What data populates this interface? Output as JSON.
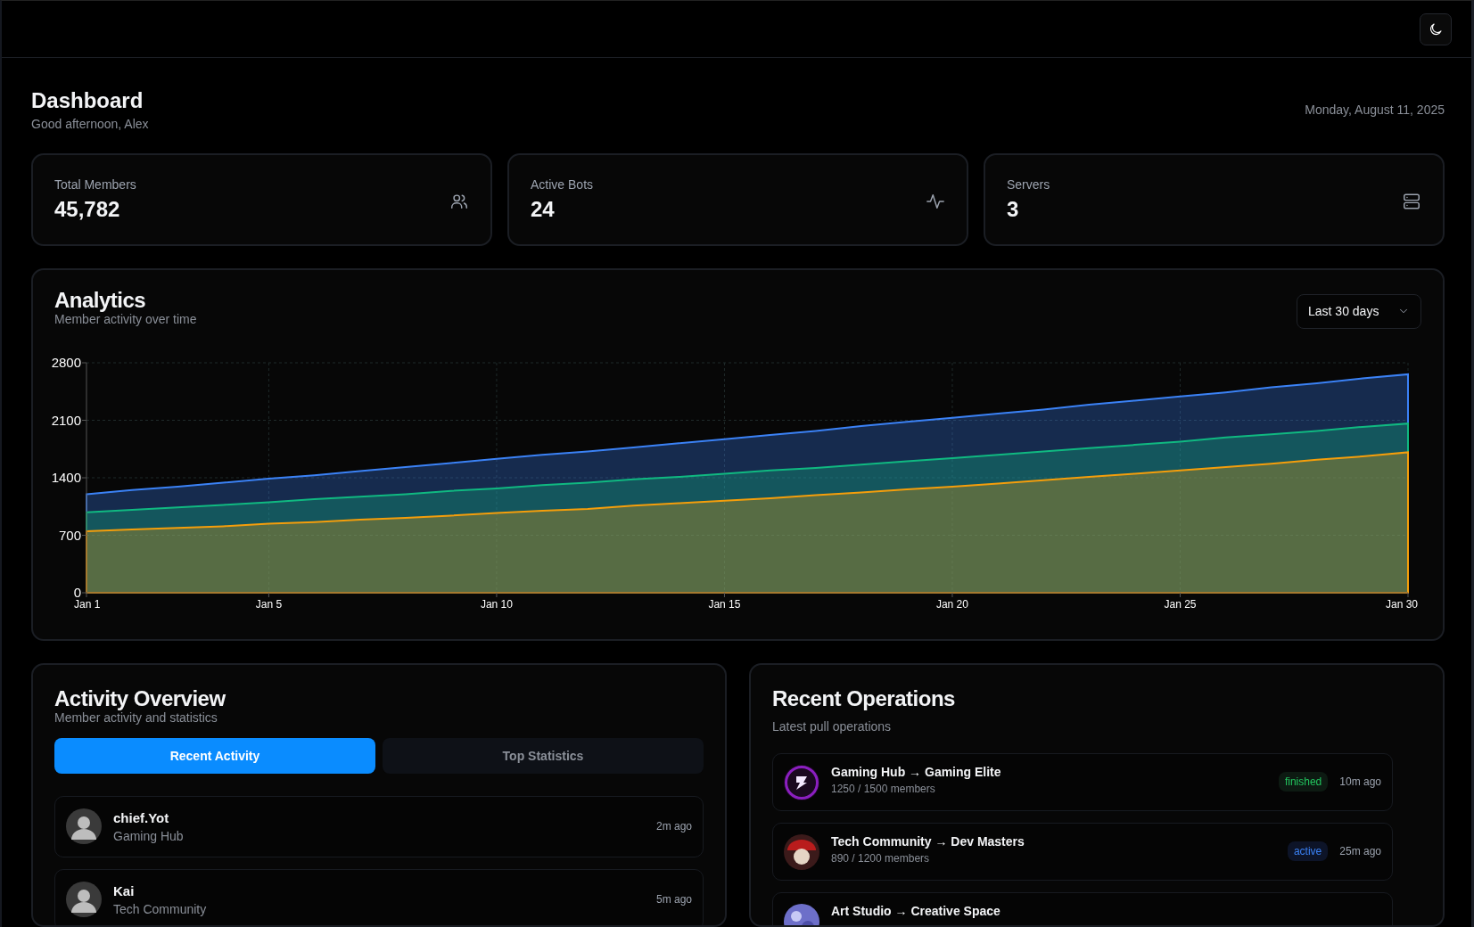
{
  "topbar": {
    "theme_toggle": {
      "kind": "moon"
    }
  },
  "header": {
    "title": "Dashboard",
    "greeting": "Good afternoon, Alex",
    "date": "Monday, August 11, 2025"
  },
  "stats": [
    {
      "label": "Total Members",
      "value": "45,782"
    },
    {
      "label": "Active Bots",
      "value": "24"
    },
    {
      "label": "Servers",
      "value": "3"
    }
  ],
  "analytics": {
    "title": "Analytics",
    "subtitle": "Member activity over time",
    "range": "Last 30 days",
    "chart_data": {
      "type": "area",
      "categories": [
        "Jan 1",
        null,
        null,
        null,
        "Jan 5",
        null,
        null,
        null,
        null,
        "Jan 10",
        null,
        null,
        null,
        null,
        "Jan 15",
        null,
        null,
        null,
        null,
        "Jan 20",
        null,
        null,
        null,
        null,
        "Jan 25",
        null,
        null,
        null,
        null,
        "Jan 30"
      ],
      "series": [
        {
          "color": "#3b82f6",
          "values": [
            1200,
            1250,
            1290,
            1340,
            1390,
            1430,
            1480,
            1530,
            1580,
            1630,
            1680,
            1720,
            1770,
            1820,
            1870,
            1920,
            1970,
            2030,
            2080,
            2130,
            2180,
            2230,
            2290,
            2340,
            2390,
            2440,
            2500,
            2550,
            2610,
            2660
          ]
        },
        {
          "color": "#10b981",
          "values": [
            980,
            1010,
            1040,
            1070,
            1100,
            1140,
            1170,
            1200,
            1240,
            1270,
            1310,
            1340,
            1380,
            1410,
            1450,
            1490,
            1520,
            1560,
            1600,
            1640,
            1680,
            1720,
            1760,
            1800,
            1840,
            1890,
            1930,
            1970,
            2020,
            2060
          ]
        },
        {
          "color": "#f59e0b",
          "values": [
            750,
            770,
            790,
            810,
            840,
            860,
            890,
            910,
            940,
            970,
            1000,
            1020,
            1060,
            1090,
            1120,
            1150,
            1190,
            1220,
            1260,
            1290,
            1330,
            1370,
            1410,
            1450,
            1490,
            1530,
            1570,
            1620,
            1660,
            1710
          ]
        }
      ],
      "ylim": [
        0,
        2800
      ],
      "yticks": [
        0,
        700,
        1400,
        2100,
        2800
      ],
      "stacked": false,
      "grid": true
    }
  },
  "activity": {
    "title": "Activity Overview",
    "subtitle": "Member activity and statistics",
    "tabs": [
      {
        "label": "Recent Activity",
        "selected": true
      },
      {
        "label": "Top Statistics",
        "selected": false
      }
    ],
    "items": [
      {
        "name": "chief.Yot",
        "server": "Gaming Hub",
        "time": "2m ago"
      },
      {
        "name": "Kai",
        "server": "Tech Community",
        "time": "5m ago"
      }
    ]
  },
  "operations": {
    "title": "Recent Operations",
    "subtitle": "Latest pull operations",
    "items": [
      {
        "title": "Gaming Hub → Gaming Elite",
        "members": "1250 / 1500 members",
        "kind": "finished",
        "status": "finished",
        "time": "10m ago"
      },
      {
        "title": "Tech Community → Dev Masters",
        "members": "890 / 1200 members",
        "kind": "active",
        "status": "active",
        "time": "25m ago"
      },
      {
        "title": "Art Studio → Creative Space"
      }
    ]
  }
}
